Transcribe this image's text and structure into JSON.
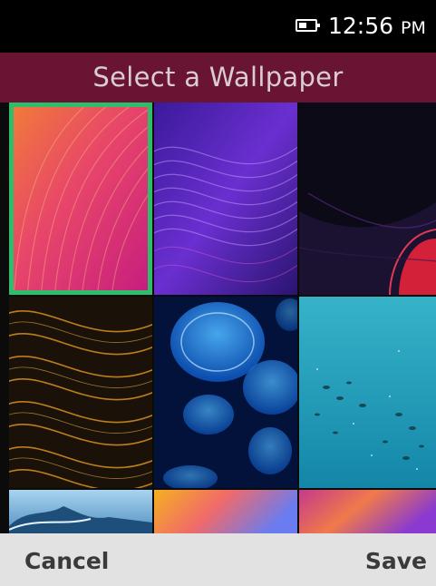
{
  "status_bar": {
    "icons": [
      "battery-icon"
    ],
    "time": "12:56",
    "ampm": "PM"
  },
  "header": {
    "title": "Select a Wallpaper",
    "background": "#6a1433"
  },
  "wallpapers": {
    "selected_index": 0,
    "selection_color": "#2ebd6b",
    "items": [
      {
        "name": "pink-swirl"
      },
      {
        "name": "purple-waves"
      },
      {
        "name": "dark-red-curves"
      },
      {
        "name": "golden-streaks"
      },
      {
        "name": "blue-jellyfish"
      },
      {
        "name": "turquoise-ocean-fish"
      },
      {
        "name": "sky-water-splash"
      },
      {
        "name": "orange-pink-gradient"
      },
      {
        "name": "purple-orange-gradient"
      }
    ]
  },
  "softkeys": {
    "left_label": "Cancel",
    "right_label": "Save"
  }
}
